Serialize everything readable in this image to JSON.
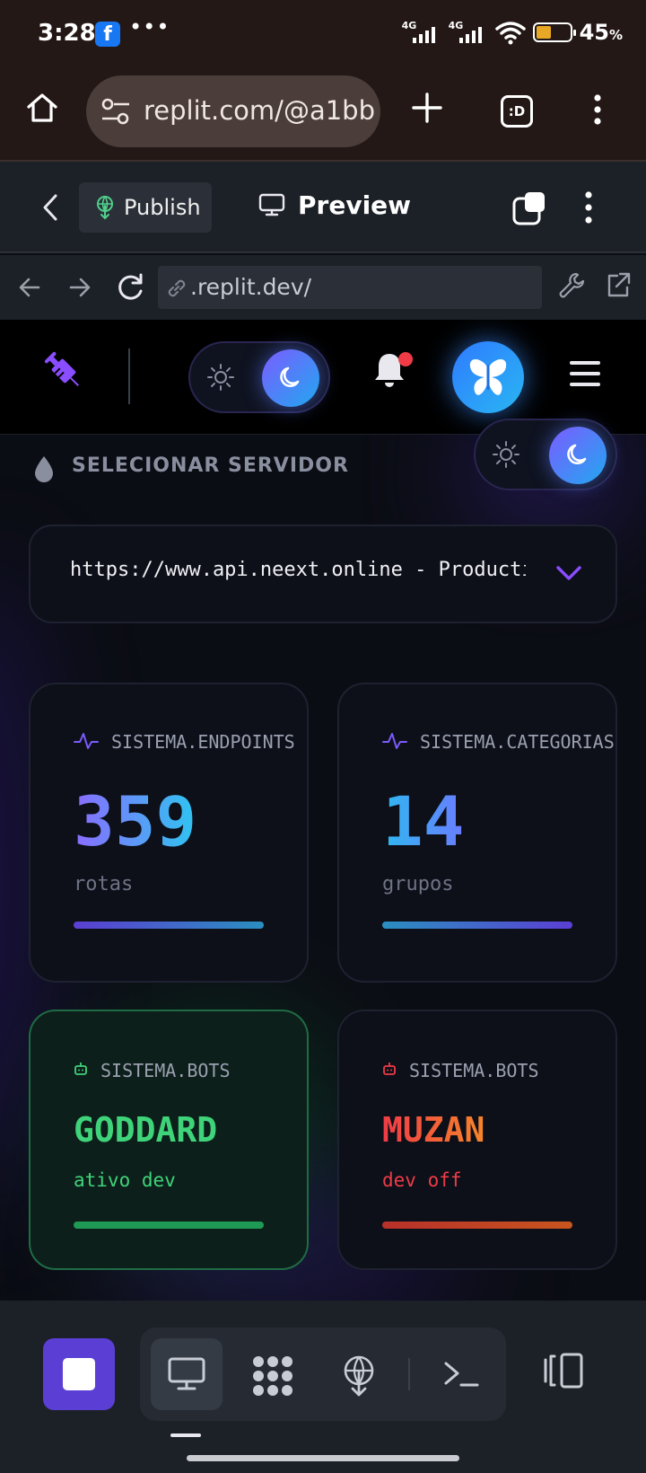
{
  "status_bar": {
    "time": "3:28",
    "network_1": "4G",
    "network_2": "4G",
    "battery_pct": "45",
    "battery_unit": "%",
    "battery_level": 0.45
  },
  "browser": {
    "url": "replit.com/@a1bb",
    "tabs_label": ":D"
  },
  "replit_header": {
    "publish_label": "Publish",
    "preview_label": "Preview"
  },
  "webview_nav": {
    "url": ".replit.dev/"
  },
  "app": {
    "server_label": "SELECIONAR SERVIDOR",
    "server_value": "https://www.api.neext.online - Production",
    "stats": [
      {
        "label": "SISTEMA.ENDPOINTS",
        "value": "359",
        "unit": "rotas"
      },
      {
        "label": "SISTEMA.CATEGORIAS",
        "value": "14",
        "unit": "grupos"
      }
    ],
    "bots": [
      {
        "label": "SISTEMA.BOTS",
        "name": "GODDARD",
        "status": "ativo dev",
        "color": "#3fd37a"
      },
      {
        "label": "SISTEMA.BOTS",
        "name": "MUZAN",
        "status": "dev off",
        "color": "#f0563c"
      }
    ]
  },
  "colors": {
    "accent_purple": "#7b5cff",
    "accent_cyan": "#21a8f0",
    "browser_chrome": "#231816",
    "replit_chrome": "#1c2027"
  },
  "icons": [
    "home-icon",
    "tune-icon",
    "plus-icon",
    "more-icon",
    "back-icon",
    "publish-icon",
    "monitor-icon",
    "window-icon",
    "arrow-left-icon",
    "arrow-right-icon",
    "reload-icon",
    "link-icon",
    "wrench-icon",
    "open-external-icon",
    "syringe-icon",
    "sun-icon",
    "moon-icon",
    "bell-icon",
    "butterfly-icon",
    "menu-icon",
    "droplet-icon",
    "chevron-down-icon",
    "activity-icon",
    "bot-icon",
    "stop-icon",
    "workflows-icon",
    "deploy-icon",
    "terminal-icon",
    "sidebar-icon"
  ]
}
